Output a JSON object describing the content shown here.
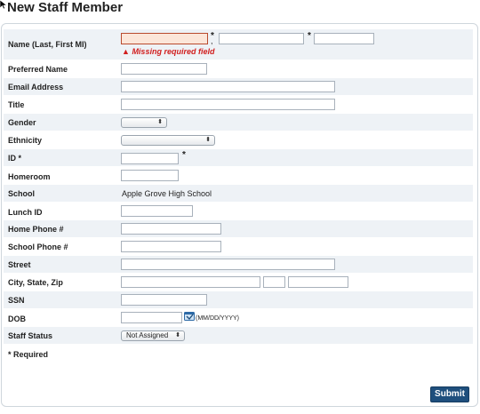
{
  "page": {
    "title": "New Staff Member"
  },
  "form": {
    "name": {
      "label": "Name (Last, First MI)",
      "last": "",
      "first": "",
      "mi": "",
      "req_mark": "*",
      "error": "Missing required field",
      "error_icon": "▲"
    },
    "preferred_name": {
      "label": "Preferred Name",
      "value": ""
    },
    "email": {
      "label": "Email Address",
      "value": ""
    },
    "title": {
      "label": "Title",
      "value": ""
    },
    "gender": {
      "label": "Gender",
      "selected": ""
    },
    "ethnicity": {
      "label": "Ethnicity",
      "selected": ""
    },
    "id": {
      "label": "ID *",
      "value": "",
      "req_mark": "*"
    },
    "homeroom": {
      "label": "Homeroom",
      "value": ""
    },
    "school": {
      "label": "School",
      "value": "Apple Grove High School"
    },
    "lunch_id": {
      "label": "Lunch ID",
      "value": ""
    },
    "home_phone": {
      "label": "Home Phone #",
      "value": ""
    },
    "school_phone": {
      "label": "School Phone #",
      "value": ""
    },
    "street": {
      "label": "Street",
      "value": ""
    },
    "city_state_zip": {
      "label": "City, State, Zip",
      "city": "",
      "state": "",
      "zip": ""
    },
    "ssn": {
      "label": "SSN",
      "value": ""
    },
    "dob": {
      "label": "DOB",
      "value": "",
      "hint": "(MM/DD/YYYY)",
      "icon": "calendar-icon"
    },
    "staff_status": {
      "label": "Staff Status",
      "selected": "Not Assigned"
    },
    "required_note": "* Required",
    "submit_label": "Submit"
  },
  "colors": {
    "accent": "#1f4f7d",
    "error": "#d11f1f",
    "error_field_bg": "#fce6d9",
    "row_alt_bg": "#eef2f6"
  }
}
